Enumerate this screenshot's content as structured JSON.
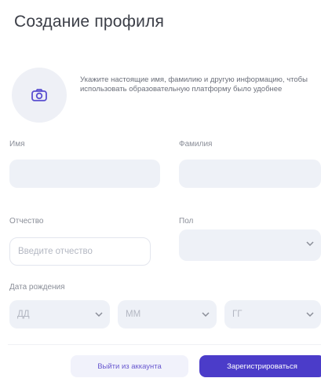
{
  "page": {
    "title": "Создание профиля"
  },
  "avatar": {
    "icon": "camera-icon"
  },
  "hint": "Укажите настоящие имя, фамилию и другую информацию, чтобы использовать образовательную платформу было удобнее",
  "form": {
    "first_name": {
      "label": "Имя",
      "value": ""
    },
    "last_name": {
      "label": "Фамилия",
      "value": ""
    },
    "patronymic": {
      "label": "Отчество",
      "placeholder": "Введите отчество"
    },
    "gender": {
      "label": "Пол",
      "value": ""
    },
    "birthdate": {
      "label": "Дата рождения",
      "day_placeholder": "ДД",
      "month_placeholder": "ММ",
      "year_placeholder": "ГГ"
    }
  },
  "actions": {
    "logout_label": "Выйти из аккаунта",
    "register_label": "Зарегистрироваться"
  }
}
